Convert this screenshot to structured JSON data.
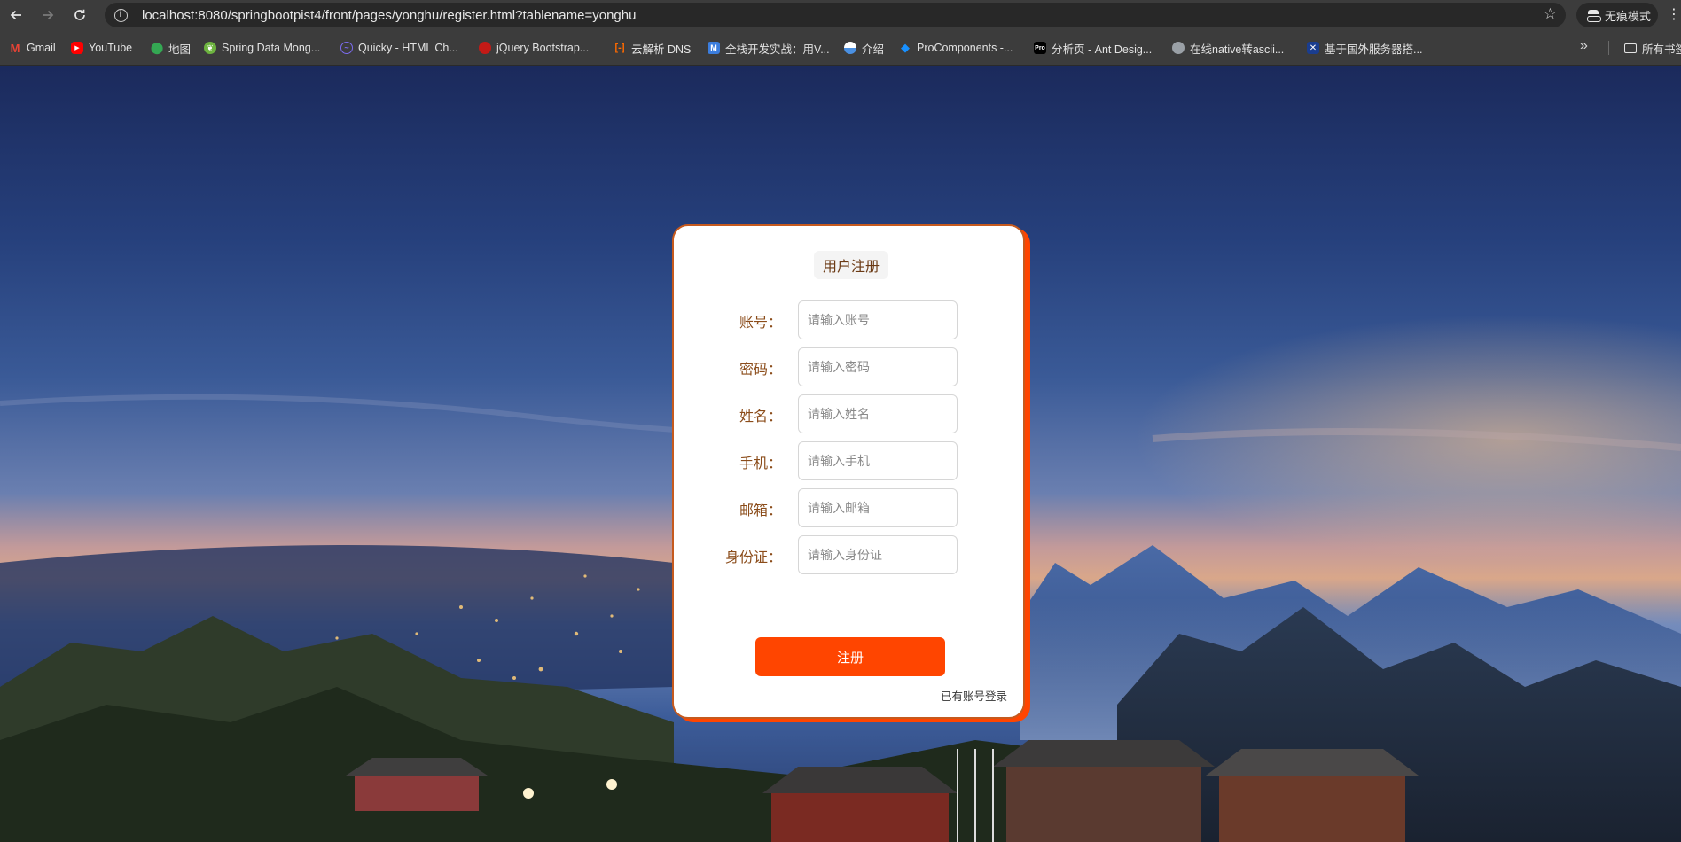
{
  "browser": {
    "url": "localhost:8080/springbootpist4/front/pages/yonghu/register.html?tablename=yonghu",
    "incognito_label": "无痕模式",
    "bookmarks": [
      {
        "label": "Gmail",
        "icon": "gmail-icon",
        "color": "#ea4335"
      },
      {
        "label": "YouTube",
        "icon": "youtube-icon",
        "color": "#ff0000"
      },
      {
        "label": "地图",
        "icon": "maps-icon",
        "color": "#34a853"
      },
      {
        "label": "Spring Data Mong...",
        "icon": "spring-icon",
        "color": "#6db33f"
      },
      {
        "label": "Quicky - HTML Ch...",
        "icon": "quicky-icon",
        "color": "#7c6cf0"
      },
      {
        "label": "jQuery Bootstrap...",
        "icon": "jquery-icon",
        "color": "#c41a16"
      },
      {
        "label": "云解析 DNS",
        "icon": "aliyun-icon",
        "color": "#ff6a00"
      },
      {
        "label": "全栈开发实战：用V...",
        "icon": "m-icon",
        "color": "#3b7ddd"
      },
      {
        "label": "介绍",
        "icon": "globe-blue-icon",
        "color": "#4a90e2"
      },
      {
        "label": "ProComponents -...",
        "icon": "procomponents-icon",
        "color": "#1890ff"
      },
      {
        "label": "分析页 - Ant Desig...",
        "icon": "pro-icon",
        "color": "#000000"
      },
      {
        "label": "在线native转ascii...",
        "icon": "globe-icon",
        "color": "#9aa0a6"
      },
      {
        "label": "基于国外服务器搭...",
        "icon": "flag-icon",
        "color": "#1a3d8f"
      }
    ],
    "all_bookmarks_label": "所有书签"
  },
  "form": {
    "title": "用户注册",
    "fields": [
      {
        "label": "账号：",
        "placeholder": "请输入账号"
      },
      {
        "label": "密码：",
        "placeholder": "请输入密码"
      },
      {
        "label": "姓名：",
        "placeholder": "请输入姓名"
      },
      {
        "label": "手机：",
        "placeholder": "请输入手机"
      },
      {
        "label": "邮箱：",
        "placeholder": "请输入邮箱"
      },
      {
        "label": "身份证：",
        "placeholder": "请输入身份证"
      }
    ],
    "submit_label": "注册",
    "login_link": "已有账号登录"
  },
  "colors": {
    "accent": "#ff4500",
    "label": "#8b4c1a"
  }
}
